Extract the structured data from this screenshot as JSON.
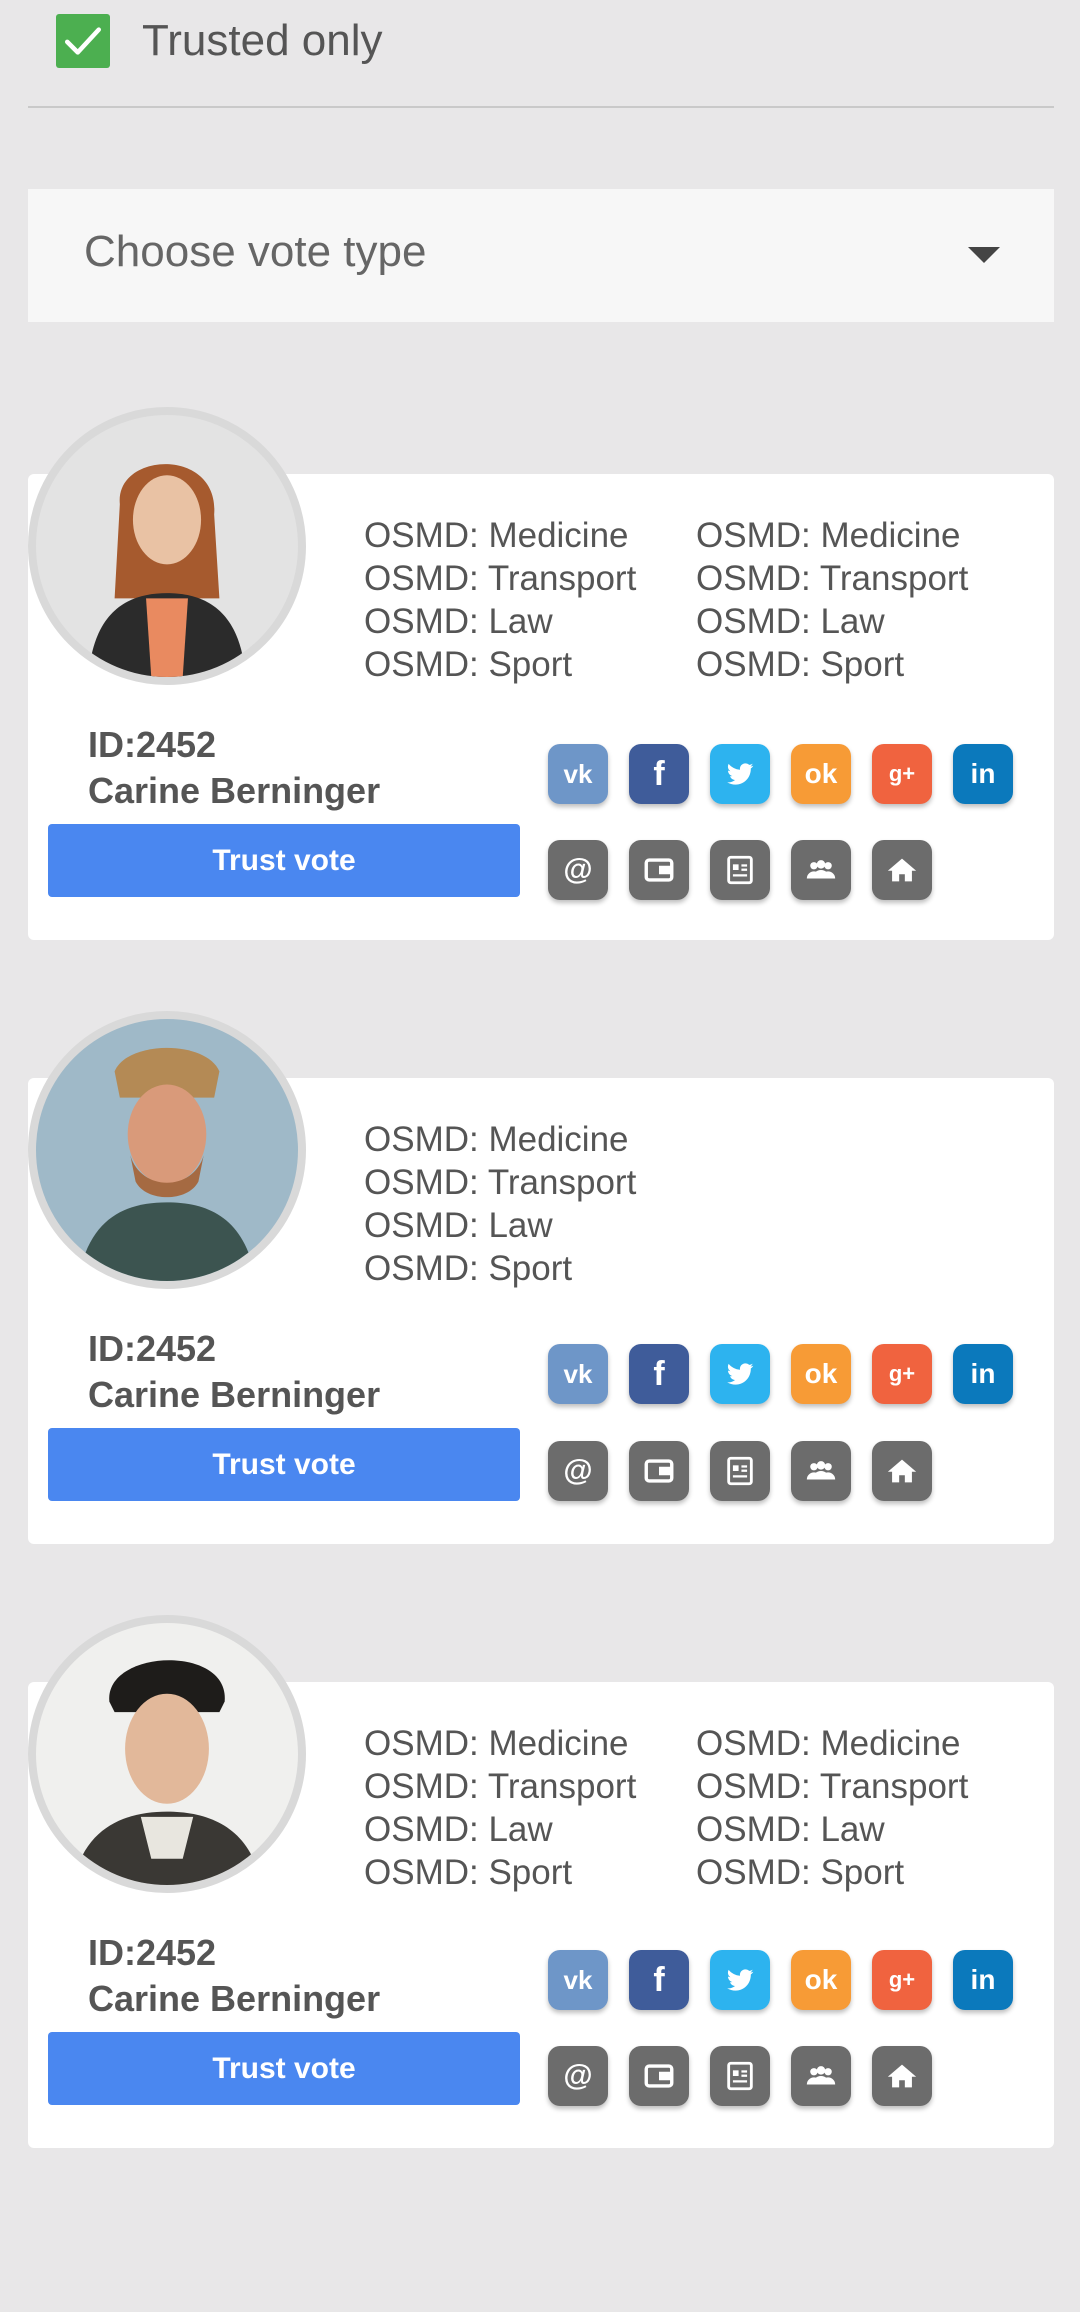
{
  "filter": {
    "trusted_only_label": "Trusted only",
    "trusted_only_checked": true
  },
  "vote_select": {
    "placeholder": "Choose vote type"
  },
  "colors": {
    "checkbox": "#4caf50",
    "trust_button": "#4a87f0",
    "vk": "#6e96c8",
    "facebook": "#3f5c9a",
    "twitter": "#2db3ef",
    "odnoklassniki": "#f79b36",
    "google_plus": "#f0633f",
    "linkedin": "#0b79bc",
    "tool_icons": "#6c6c6c"
  },
  "cards": [
    {
      "id_text": "ID:2452",
      "name": "Carine Berninger",
      "button_label": "Trust vote",
      "tags_col1": [
        "OSMD: Medicine",
        "OSMD: Transport",
        "OSMD: Law",
        "OSMD: Sport"
      ],
      "tags_col2": [
        "OSMD: Medicine",
        "OSMD: Transport",
        "OSMD: Law",
        "OSMD: Sport"
      ]
    },
    {
      "id_text": "ID:2452",
      "name": "Carine Berninger",
      "button_label": "Trust vote",
      "tags_col1": [
        "OSMD: Medicine",
        "OSMD: Transport",
        "OSMD: Law",
        "OSMD: Sport"
      ],
      "tags_col2": []
    },
    {
      "id_text": "ID:2452",
      "name": "Carine Berninger",
      "button_label": "Trust vote",
      "tags_col1": [
        "OSMD: Medicine",
        "OSMD: Transport",
        "OSMD: Law",
        "OSMD: Sport"
      ],
      "tags_col2": [
        "OSMD: Medicine",
        "OSMD: Transport",
        "OSMD: Law",
        "OSMD: Sport"
      ]
    }
  ],
  "social_icons": [
    {
      "name": "vk-icon",
      "glyph": "vk"
    },
    {
      "name": "facebook-icon",
      "glyph": "f"
    },
    {
      "name": "twitter-icon",
      "glyph": "t"
    },
    {
      "name": "odnoklassniki-icon",
      "glyph": "ok"
    },
    {
      "name": "google-plus-icon",
      "glyph": "g+"
    },
    {
      "name": "linkedin-icon",
      "glyph": "in"
    }
  ],
  "tool_icons": [
    {
      "name": "email-icon",
      "glyph": "@"
    },
    {
      "name": "wallet-icon"
    },
    {
      "name": "id-card-icon"
    },
    {
      "name": "group-icon"
    },
    {
      "name": "home-icon"
    }
  ]
}
